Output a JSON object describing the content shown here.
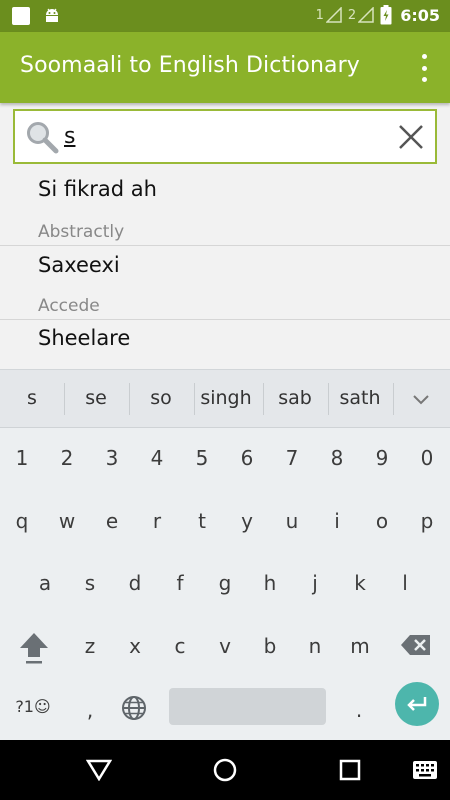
{
  "status_bar": {
    "sim1": "1",
    "sim2": "2",
    "battery_level": "6",
    "time": "6:05"
  },
  "app_bar": {
    "title": "Soomaali to English Dictionary",
    "menu_icon": "more-vert-icon"
  },
  "search": {
    "value": "s",
    "search_icon": "magnifier-icon",
    "clear_icon": "close-icon"
  },
  "results": [
    {
      "somali": "Si fikrad ah",
      "english": "Abstractly"
    },
    {
      "somali": "Saxeexi",
      "english": "Accede"
    },
    {
      "somali": "Sheelare",
      "english": ""
    }
  ],
  "keyboard": {
    "suggestions": [
      "s",
      "se",
      "so",
      "singh",
      "sab",
      "sath"
    ],
    "row_numbers": [
      "1",
      "2",
      "3",
      "4",
      "5",
      "6",
      "7",
      "8",
      "9",
      "0"
    ],
    "row_top": [
      "q",
      "w",
      "e",
      "r",
      "t",
      "y",
      "u",
      "i",
      "o",
      "p"
    ],
    "row_middle": [
      "a",
      "s",
      "d",
      "f",
      "g",
      "h",
      "j",
      "k",
      "l"
    ],
    "row_bottom": [
      "z",
      "x",
      "c",
      "v",
      "b",
      "n",
      "m"
    ],
    "symbols_key": "?1☺",
    "comma_key": ",",
    "period_key": ".",
    "accent": "#4db6ac"
  },
  "colors": {
    "status_bar": "#6b8e1e",
    "app_bar": "#8bb22a",
    "search_border": "#9aba38"
  }
}
